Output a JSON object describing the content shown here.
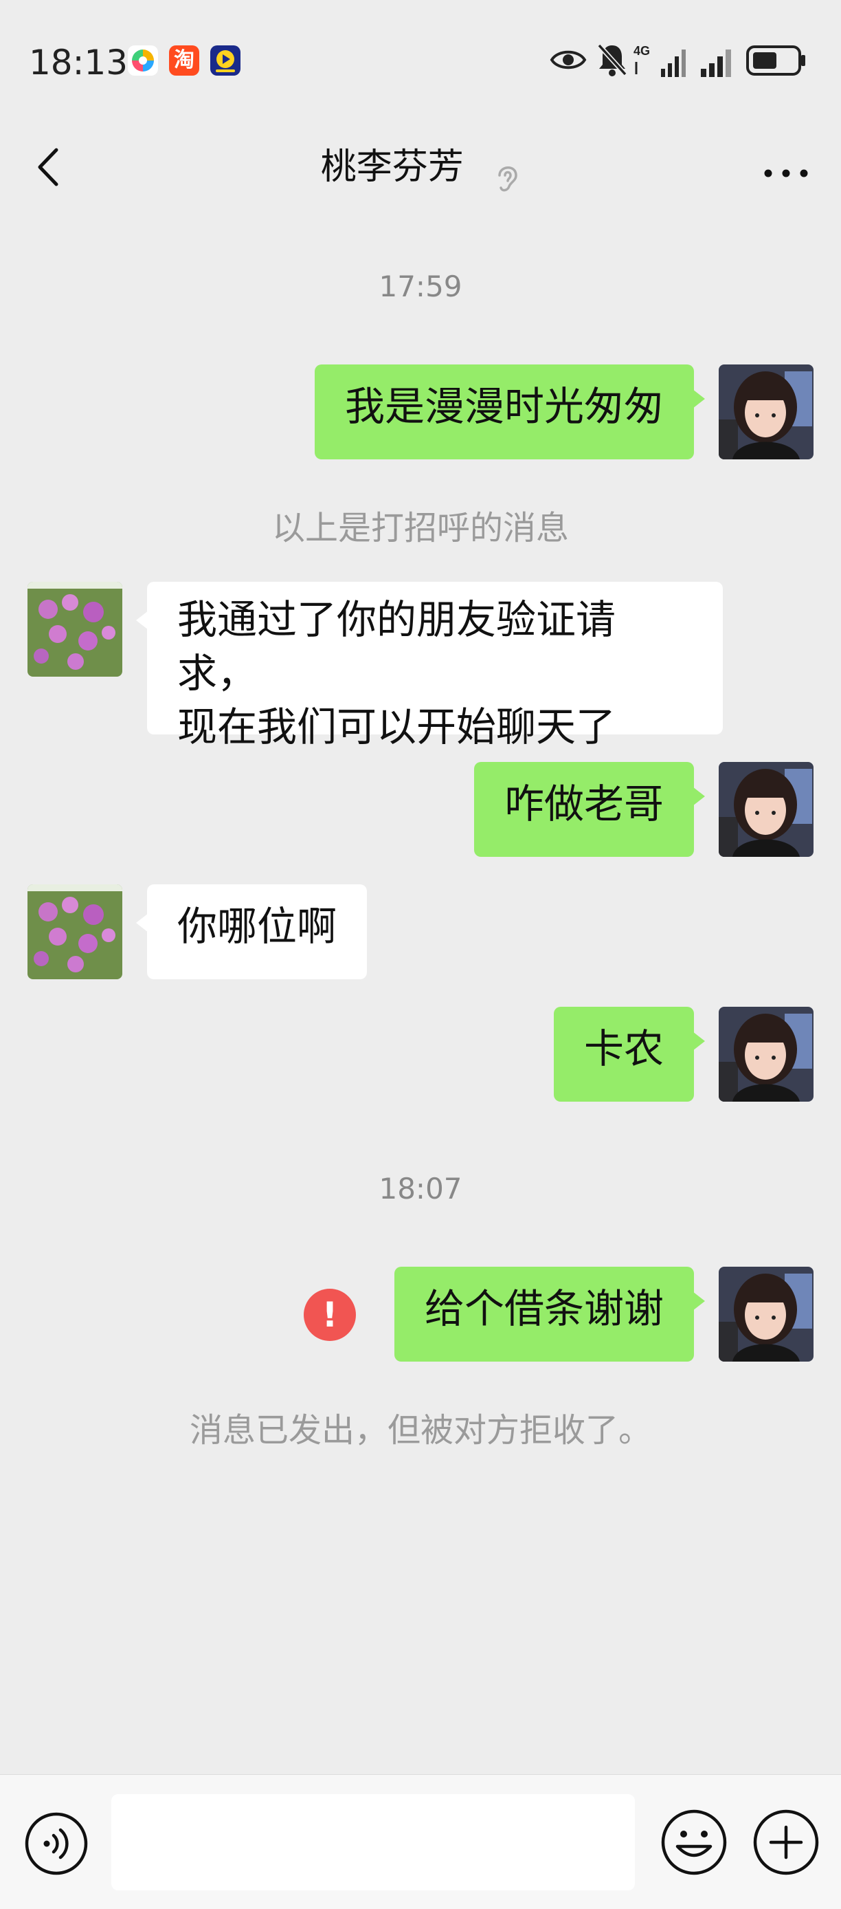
{
  "status_bar": {
    "time": "18:13",
    "app_icons": [
      "multicolor-app-icon",
      "taobao-icon",
      "video-app-icon"
    ],
    "taobao_label": "淘",
    "right_icons": [
      "eye-icon",
      "mute-bell-icon",
      "4g-signal-icon",
      "signal-icon",
      "battery-icon"
    ],
    "network_label": "4G"
  },
  "navbar": {
    "title": "桃李芬芳",
    "back_icon": "chevron-left-icon",
    "ear_icon": "ear-icon",
    "more_icon": "more-dots-icon"
  },
  "messages": [
    {
      "type": "timestamp",
      "text": "17:59"
    },
    {
      "type": "message",
      "side": "me",
      "text": "我是漫漫时光匆匆"
    },
    {
      "type": "system",
      "text": "以上是打招呼的消息"
    },
    {
      "type": "message",
      "side": "other",
      "lines": [
        "我通过了你的朋友验证请求，",
        "现在我们可以开始聊天了"
      ]
    },
    {
      "type": "message",
      "side": "me",
      "text": "咋做老哥"
    },
    {
      "type": "message",
      "side": "other",
      "text": "你哪位啊"
    },
    {
      "type": "message",
      "side": "me",
      "text": "卡农"
    },
    {
      "type": "timestamp",
      "text": "18:07"
    },
    {
      "type": "message",
      "side": "me",
      "text": "给个借条谢谢",
      "error_mark": "!"
    },
    {
      "type": "system",
      "text": "消息已发出，但被对方拒收了。"
    }
  ],
  "input_bar": {
    "value": "",
    "placeholder": "",
    "left_icon": "voice-icon",
    "emoji_icon": "emoji-icon",
    "plus_icon": "plus-icon"
  },
  "colors": {
    "background": "#ededed",
    "my_bubble": "#95ec69",
    "other_bubble": "#ffffff",
    "error": "#f15552"
  }
}
